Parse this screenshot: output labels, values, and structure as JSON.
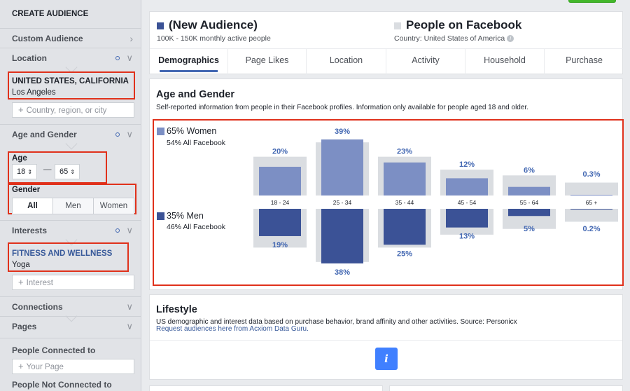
{
  "sidebar": {
    "title": "CREATE AUDIENCE",
    "custom_audience": "Custom Audience",
    "location": {
      "heading": "Location",
      "selected_title": "UNITED STATES, CALIFORNIA",
      "selected_sub": "Los Angeles",
      "input_placeholder": "Country, region, or city"
    },
    "age_gender": {
      "heading": "Age and Gender",
      "age_label": "Age",
      "age_min": "18",
      "age_max": "65",
      "age_dash": "—",
      "gender_label": "Gender",
      "gender_options": [
        "All",
        "Men",
        "Women"
      ],
      "gender_selected": "All"
    },
    "interests": {
      "heading": "Interests",
      "selected_title": "FITNESS AND WELLNESS",
      "selected_sub": "Yoga",
      "input_placeholder": "Interest"
    },
    "connections": "Connections",
    "pages": "Pages",
    "people_connected": "People Connected to",
    "page_placeholder": "Your Page",
    "people_not_connected": "People Not Connected to"
  },
  "header": {
    "new_audience_title": "(New Audience)",
    "new_audience_sub": "100K - 150K monthly active people",
    "fb_title": "People on Facebook",
    "fb_sub": "Country: United States of America",
    "tabs": [
      "Demographics",
      "Page Likes",
      "Location",
      "Activity",
      "Household",
      "Purchase"
    ],
    "active_tab": "Demographics"
  },
  "age_gender_card": {
    "title": "Age and Gender",
    "description": "Self-reported information from people in their Facebook profiles. Information only available for people aged 18 and older.",
    "women_label": "65% Women",
    "women_sub": "54% All Facebook",
    "men_label": "35% Men",
    "men_sub": "46% All Facebook"
  },
  "chart_data": {
    "type": "bar",
    "categories": [
      "18 - 24",
      "25 - 34",
      "35 - 44",
      "45 - 54",
      "55 - 64",
      "65 +"
    ],
    "series": [
      {
        "name": "Women",
        "values": [
          20,
          39,
          23,
          12,
          6,
          0.3
        ],
        "labels": [
          "20%",
          "39%",
          "23%",
          "12%",
          "6%",
          "0.3%"
        ]
      },
      {
        "name": "Men",
        "values": [
          19,
          38,
          25,
          13,
          5,
          0.2
        ],
        "labels": [
          "19%",
          "38%",
          "25%",
          "13%",
          "5%",
          "0.2%"
        ]
      }
    ],
    "background_bars": {
      "values": [
        27,
        37,
        27,
        18,
        14,
        9
      ]
    },
    "colors": {
      "women": "#7c8fc4",
      "men": "#3b5296",
      "background": "#dadde1",
      "label": "#4267b2"
    }
  },
  "lifestyle_card": {
    "title": "Lifestyle",
    "description": "US demographic and interest data based on purchase behavior, brand affinity and other activities. Source: Personicx",
    "link": "Request audiences here from Acxiom Data Guru."
  },
  "icons": {
    "info_button": "i",
    "chevron": "❯",
    "plus": "+"
  }
}
